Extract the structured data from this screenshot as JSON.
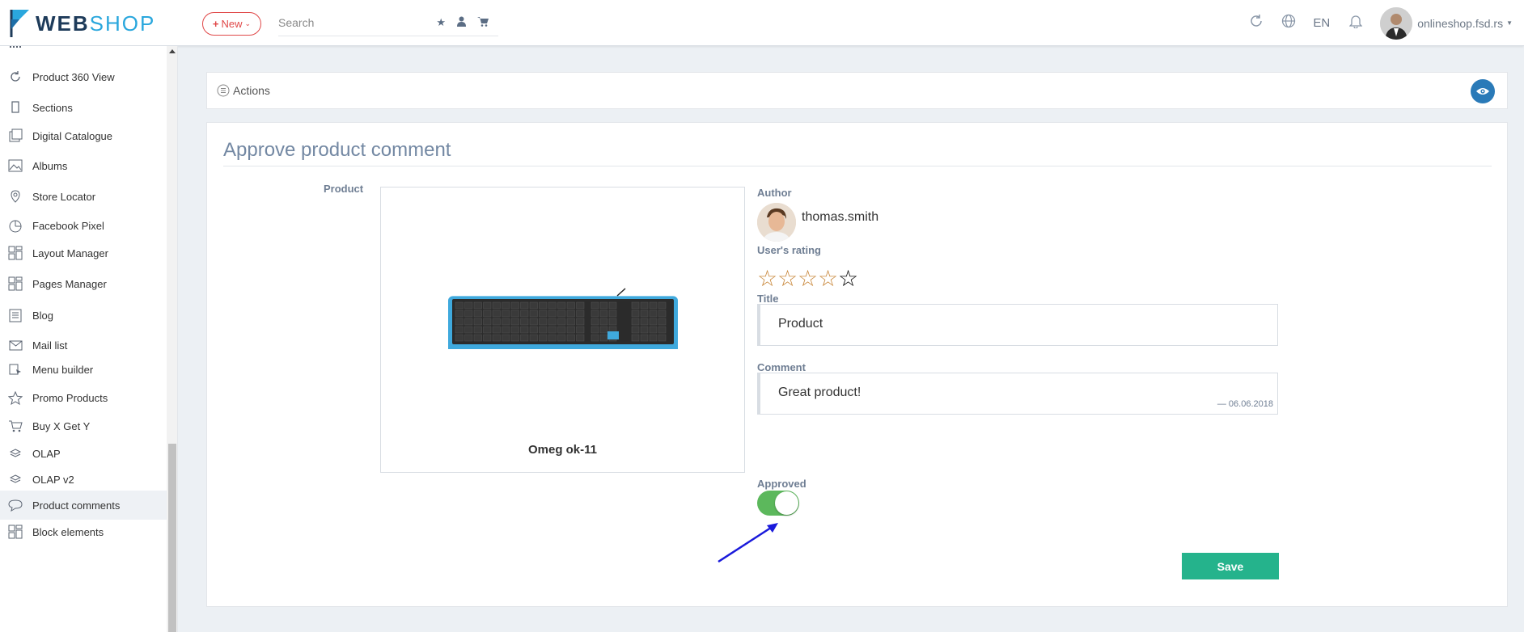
{
  "brand": {
    "part1": "WEB",
    "part2": "SHOP"
  },
  "topbar": {
    "new_label": "New",
    "search_placeholder": "Search",
    "language": "EN",
    "user_name": "onlineshop.fsd.rs"
  },
  "sidebar": {
    "items": [
      {
        "label": "Product 360 View",
        "icon": "rotate-icon"
      },
      {
        "label": "Sections",
        "icon": "tablet-icon"
      },
      {
        "label": "Digital Catalogue",
        "icon": "catalogue-icon"
      },
      {
        "label": "Albums",
        "icon": "image-icon"
      },
      {
        "label": "Store Locator",
        "icon": "map-icon"
      },
      {
        "label": "Facebook Pixel",
        "icon": "pie-chart-icon"
      },
      {
        "label": "Layout Manager",
        "icon": "layout-icon"
      },
      {
        "label": "Pages Manager",
        "icon": "layout-icon"
      },
      {
        "label": "Blog",
        "icon": "blog-icon"
      },
      {
        "label": "Mail list",
        "icon": "mail-icon"
      },
      {
        "label": "Menu builder",
        "icon": "menu-icon"
      },
      {
        "label": "Promo Products",
        "icon": "star-icon"
      },
      {
        "label": "Buy X Get Y",
        "icon": "cart-icon"
      },
      {
        "label": "OLAP",
        "icon": "layers-icon"
      },
      {
        "label": "OLAP v2",
        "icon": "layers-icon"
      },
      {
        "label": "Product comments",
        "icon": "comment-icon",
        "active": true
      },
      {
        "label": "Block elements",
        "icon": "layout-icon"
      }
    ]
  },
  "actions": {
    "label": "Actions"
  },
  "form": {
    "title": "Approve product comment",
    "product_label": "Product",
    "product_name": "Omeg ok-11",
    "author_label": "Author",
    "author_name": "thomas.smith",
    "rating_label": "User's rating",
    "rating": 4,
    "rating_max": 5,
    "title_label": "Title",
    "title_value": "Product",
    "comment_label": "Comment",
    "comment_value": "Great product!",
    "comment_date": "— 06.06.2018",
    "approved_label": "Approved",
    "approved": true,
    "save_label": "Save"
  },
  "colors": {
    "accent_red": "#e04848",
    "save_green": "#25b38c",
    "toggle_green": "#5cb85c",
    "eye_blue": "#2a7ab8",
    "star_gold": "#c8873a"
  }
}
